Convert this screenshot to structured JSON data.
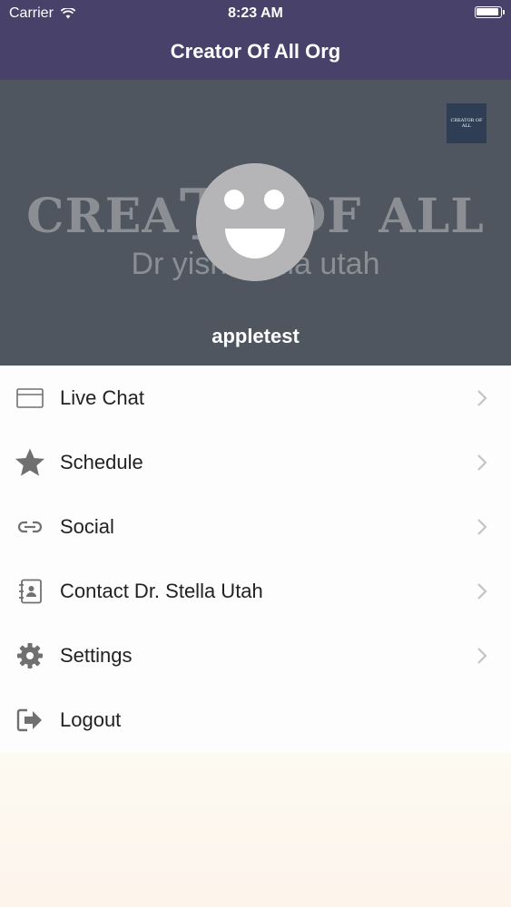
{
  "status": {
    "carrier": "Carrier",
    "time": "8:23 AM"
  },
  "nav": {
    "title": "Creator Of All Org"
  },
  "banner": {
    "logo_prefix": "CREA",
    "logo_big": "T",
    "logo_suffix": "OF ALL",
    "subtitle": "Dr yishra  ella utah",
    "thumb_text": "CREATOR OF ALL",
    "username": "appletest"
  },
  "menu": {
    "items": [
      {
        "label": "Live Chat",
        "icon": "chat-box-icon",
        "chevron": true
      },
      {
        "label": "Schedule",
        "icon": "star-icon",
        "chevron": true
      },
      {
        "label": "Social",
        "icon": "link-icon",
        "chevron": true
      },
      {
        "label": "Contact Dr. Stella Utah",
        "icon": "contact-book-icon",
        "chevron": true
      },
      {
        "label": "Settings",
        "icon": "gear-icon",
        "chevron": true
      },
      {
        "label": "Logout",
        "icon": "logout-icon",
        "chevron": false
      }
    ]
  },
  "colors": {
    "nav_bg": "#48416a",
    "banner_bg": "#4f5660",
    "icon_gray": "#707070",
    "chevron_gray": "#c4c4c8"
  }
}
